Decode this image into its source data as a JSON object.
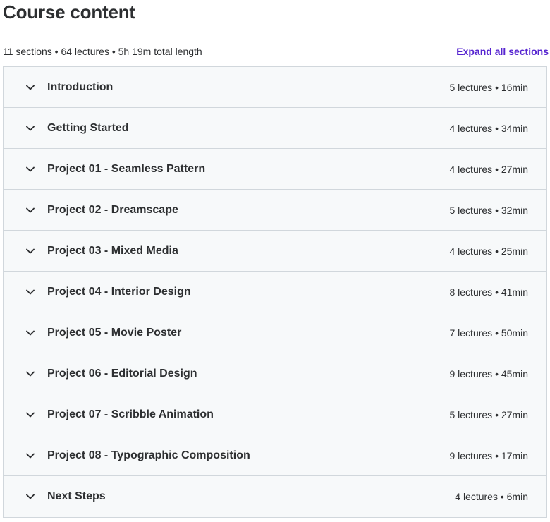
{
  "header": {
    "title": "Course content"
  },
  "summary": {
    "text": "11 sections • 64 lectures • 5h 19m total length",
    "expand_label": "Expand all sections"
  },
  "colors": {
    "accent": "#5624d0",
    "section_bg": "#f7f9fa",
    "border": "#d1d7dc",
    "text": "#2d2f31"
  },
  "sections": [
    {
      "title": "Introduction",
      "meta": "5 lectures • 16min",
      "icon": "chevron-down-icon"
    },
    {
      "title": "Getting Started",
      "meta": "4 lectures • 34min",
      "icon": "chevron-down-icon"
    },
    {
      "title": "Project 01 - Seamless Pattern",
      "meta": "4 lectures • 27min",
      "icon": "chevron-down-icon"
    },
    {
      "title": "Project 02 - Dreamscape",
      "meta": "5 lectures • 32min",
      "icon": "chevron-down-icon"
    },
    {
      "title": "Project 03 - Mixed Media",
      "meta": "4 lectures • 25min",
      "icon": "chevron-down-icon"
    },
    {
      "title": "Project 04 - Interior Design",
      "meta": "8 lectures • 41min",
      "icon": "chevron-down-icon"
    },
    {
      "title": "Project 05 - Movie Poster",
      "meta": "7 lectures • 50min",
      "icon": "chevron-down-icon"
    },
    {
      "title": "Project 06 - Editorial Design",
      "meta": "9 lectures • 45min",
      "icon": "chevron-down-icon"
    },
    {
      "title": "Project 07 - Scribble Animation",
      "meta": "5 lectures • 27min",
      "icon": "chevron-down-icon"
    },
    {
      "title": "Project 08 - Typographic Composition",
      "meta": "9 lectures • 17min",
      "icon": "chevron-down-icon"
    },
    {
      "title": "Next Steps",
      "meta": "4 lectures • 6min",
      "icon": "chevron-down-icon"
    }
  ]
}
